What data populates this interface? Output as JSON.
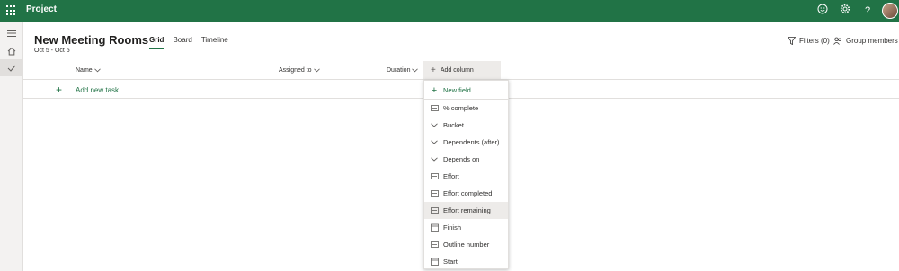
{
  "app": {
    "title": "Project"
  },
  "plan": {
    "title": "New Meeting Rooms",
    "dates": "Oct 5 - Oct 5",
    "tabs": [
      "Grid",
      "Board",
      "Timeline"
    ],
    "active_tab": "Grid"
  },
  "header_actions": {
    "filters": "Filters (0)",
    "group_members": "Group members"
  },
  "grid": {
    "columns": [
      "Name",
      "Assigned to",
      "Duration"
    ],
    "add_column": "Add column",
    "add_task": "Add new task"
  },
  "menu": {
    "items": [
      {
        "label": "New field",
        "icon": "plus-icon"
      },
      {
        "label": "% complete",
        "icon": "number-field-icon"
      },
      {
        "label": "Bucket",
        "icon": "chevron-down-icon"
      },
      {
        "label": "Dependents (after)",
        "icon": "chevron-down-icon"
      },
      {
        "label": "Depends on",
        "icon": "chevron-down-icon"
      },
      {
        "label": "Effort",
        "icon": "number-field-icon"
      },
      {
        "label": "Effort completed",
        "icon": "number-field-icon"
      },
      {
        "label": "Effort remaining",
        "icon": "number-field-icon"
      },
      {
        "label": "Finish",
        "icon": "calendar-icon"
      },
      {
        "label": "Outline number",
        "icon": "number-field-icon"
      },
      {
        "label": "Start",
        "icon": "calendar-icon"
      }
    ],
    "highlighted": "Effort remaining"
  },
  "colors": {
    "brand": "#217346",
    "highlight": "#edebe9"
  }
}
